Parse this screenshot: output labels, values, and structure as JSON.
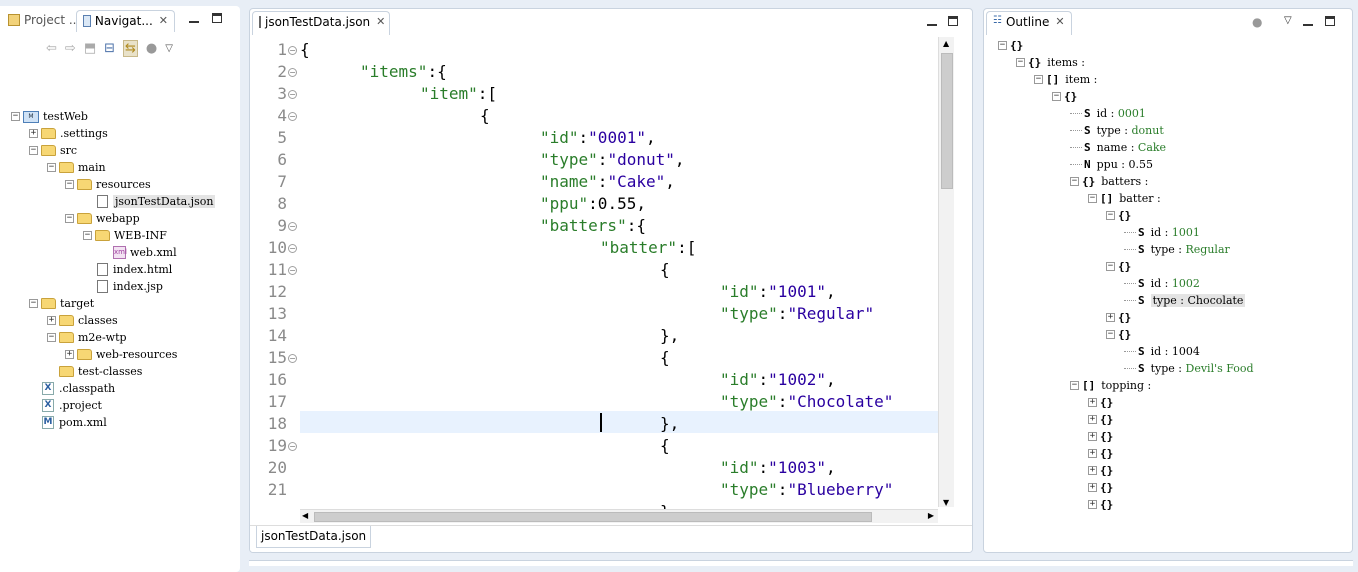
{
  "navigator": {
    "tabs": [
      {
        "label": "Project ...",
        "active": false
      },
      {
        "label": "Navigat...",
        "active": true
      }
    ],
    "tree": [
      {
        "label": "testWeb",
        "kind": "project",
        "level": 0,
        "expanded": true
      },
      {
        "label": ".settings",
        "kind": "folder",
        "level": 1,
        "expanded": false
      },
      {
        "label": "src",
        "kind": "folder",
        "level": 1,
        "expanded": true
      },
      {
        "label": "main",
        "kind": "folder",
        "level": 2,
        "expanded": true
      },
      {
        "label": "resources",
        "kind": "folder",
        "level": 3,
        "expanded": true
      },
      {
        "label": "jsonTestData.json",
        "kind": "file",
        "level": 4,
        "selected": true
      },
      {
        "label": "webapp",
        "kind": "folder",
        "level": 3,
        "expanded": true
      },
      {
        "label": "WEB-INF",
        "kind": "folder",
        "level": 4,
        "expanded": true
      },
      {
        "label": "web.xml",
        "kind": "xml",
        "level": 5
      },
      {
        "label": "index.html",
        "kind": "file",
        "level": 4
      },
      {
        "label": "index.jsp",
        "kind": "file",
        "level": 4
      },
      {
        "label": "target",
        "kind": "folder",
        "level": 1,
        "expanded": true
      },
      {
        "label": "classes",
        "kind": "folder",
        "level": 2,
        "expanded": false
      },
      {
        "label": "m2e-wtp",
        "kind": "folder",
        "level": 2,
        "expanded": true
      },
      {
        "label": "web-resources",
        "kind": "folder",
        "level": 3,
        "expanded": false
      },
      {
        "label": "test-classes",
        "kind": "folder",
        "level": 2,
        "leaf": true
      },
      {
        "label": ".classpath",
        "kind": "x",
        "level": 1
      },
      {
        "label": ".project",
        "kind": "x",
        "level": 1
      },
      {
        "label": "pom.xml",
        "kind": "m",
        "level": 1
      }
    ]
  },
  "editor": {
    "tab_label": "jsonTestData.json",
    "bottom_tab_label": "jsonTestData.json",
    "current_line": 18,
    "lines": [
      {
        "n": "1",
        "fold": true,
        "indent": 0,
        "parts": [
          [
            "punc",
            "{"
          ]
        ]
      },
      {
        "n": "2",
        "fold": true,
        "indent": 1,
        "parts": [
          [
            "key",
            "\"items\""
          ],
          [
            "punc",
            ":{"
          ]
        ]
      },
      {
        "n": "3",
        "fold": true,
        "indent": 2,
        "parts": [
          [
            "key",
            "\"item\""
          ],
          [
            "punc",
            ":["
          ]
        ]
      },
      {
        "n": "4",
        "fold": true,
        "indent": 3,
        "parts": [
          [
            "punc",
            "{"
          ]
        ]
      },
      {
        "n": "5",
        "fold": false,
        "indent": 4,
        "parts": [
          [
            "key",
            "\"id\""
          ],
          [
            "punc",
            ":"
          ],
          [
            "str",
            "\"0001\""
          ],
          [
            "punc",
            ","
          ]
        ]
      },
      {
        "n": "6",
        "fold": false,
        "indent": 4,
        "parts": [
          [
            "key",
            "\"type\""
          ],
          [
            "punc",
            ":"
          ],
          [
            "str",
            "\"donut\""
          ],
          [
            "punc",
            ","
          ]
        ]
      },
      {
        "n": "7",
        "fold": false,
        "indent": 4,
        "parts": [
          [
            "key",
            "\"name\""
          ],
          [
            "punc",
            ":"
          ],
          [
            "str",
            "\"Cake\""
          ],
          [
            "punc",
            ","
          ]
        ]
      },
      {
        "n": "8",
        "fold": false,
        "indent": 4,
        "parts": [
          [
            "key",
            "\"ppu\""
          ],
          [
            "punc",
            ":0.55,"
          ]
        ]
      },
      {
        "n": "9",
        "fold": true,
        "indent": 4,
        "parts": [
          [
            "key",
            "\"batters\""
          ],
          [
            "punc",
            ":{"
          ]
        ]
      },
      {
        "n": "10",
        "fold": true,
        "indent": 5,
        "parts": [
          [
            "key",
            "\"batter\""
          ],
          [
            "punc",
            ":["
          ]
        ]
      },
      {
        "n": "11",
        "fold": true,
        "indent": 6,
        "parts": [
          [
            "punc",
            "{"
          ]
        ]
      },
      {
        "n": "12",
        "fold": false,
        "indent": 7,
        "parts": [
          [
            "key",
            "\"id\""
          ],
          [
            "punc",
            ":"
          ],
          [
            "str",
            "\"1001\""
          ],
          [
            "punc",
            ","
          ]
        ]
      },
      {
        "n": "13",
        "fold": false,
        "indent": 7,
        "parts": [
          [
            "key",
            "\"type\""
          ],
          [
            "punc",
            ":"
          ],
          [
            "str",
            "\"Regular\""
          ]
        ]
      },
      {
        "n": "14",
        "fold": false,
        "indent": 6,
        "parts": [
          [
            "punc",
            "},"
          ]
        ]
      },
      {
        "n": "15",
        "fold": true,
        "indent": 6,
        "parts": [
          [
            "punc",
            "{"
          ]
        ]
      },
      {
        "n": "16",
        "fold": false,
        "indent": 7,
        "parts": [
          [
            "key",
            "\"id\""
          ],
          [
            "punc",
            ":"
          ],
          [
            "str",
            "\"1002\""
          ],
          [
            "punc",
            ","
          ]
        ]
      },
      {
        "n": "17",
        "fold": false,
        "indent": 7,
        "parts": [
          [
            "key",
            "\"type\""
          ],
          [
            "punc",
            ":"
          ],
          [
            "str",
            "\"Chocolate\""
          ]
        ]
      },
      {
        "n": "18",
        "fold": false,
        "indent": 6,
        "parts": [
          [
            "punc",
            "},"
          ]
        ]
      },
      {
        "n": "19",
        "fold": true,
        "indent": 6,
        "parts": [
          [
            "punc",
            "{"
          ]
        ]
      },
      {
        "n": "20",
        "fold": false,
        "indent": 7,
        "parts": [
          [
            "key",
            "\"id\""
          ],
          [
            "punc",
            ":"
          ],
          [
            "str",
            "\"1003\""
          ],
          [
            "punc",
            ","
          ]
        ]
      },
      {
        "n": "21",
        "fold": false,
        "indent": 7,
        "parts": [
          [
            "key",
            "\"type\""
          ],
          [
            "punc",
            ":"
          ],
          [
            "str",
            "\"Blueberry\""
          ]
        ]
      }
    ],
    "cut_line": "}"
  },
  "outline": {
    "tab_label": "Outline",
    "nodes": [
      {
        "level": 0,
        "badge": "{}",
        "label": "",
        "value": "",
        "exp": "-"
      },
      {
        "level": 1,
        "badge": "{}",
        "label": "items :",
        "value": "",
        "exp": "-"
      },
      {
        "level": 2,
        "badge": "[]",
        "label": "item :",
        "value": "",
        "exp": "-"
      },
      {
        "level": 3,
        "badge": "{}",
        "label": "",
        "value": "",
        "exp": "-"
      },
      {
        "level": 4,
        "badge": "S",
        "label": "id : ",
        "value": "0001"
      },
      {
        "level": 4,
        "badge": "S",
        "label": "type : ",
        "value": "donut"
      },
      {
        "level": 4,
        "badge": "S",
        "label": "name : ",
        "value": "Cake"
      },
      {
        "level": 4,
        "badge": "N",
        "label": "ppu : ",
        "value": "0.55",
        "plain": true
      },
      {
        "level": 4,
        "badge": "{}",
        "label": "batters :",
        "value": "",
        "exp": "-"
      },
      {
        "level": 5,
        "badge": "[]",
        "label": "batter :",
        "value": "",
        "exp": "-"
      },
      {
        "level": 6,
        "badge": "{}",
        "label": "",
        "value": "",
        "exp": "-"
      },
      {
        "level": 7,
        "badge": "S",
        "label": "id : ",
        "value": "1001"
      },
      {
        "level": 7,
        "badge": "S",
        "label": "type : ",
        "value": "Regular"
      },
      {
        "level": 6,
        "badge": "{}",
        "label": "",
        "value": "",
        "exp": "-"
      },
      {
        "level": 7,
        "badge": "S",
        "label": "id : ",
        "value": "1002"
      },
      {
        "level": 7,
        "badge": "S",
        "label": "type : ",
        "value": "Chocolate",
        "selected": true
      },
      {
        "level": 6,
        "badge": "{}",
        "label": "",
        "value": "",
        "exp": "+"
      },
      {
        "level": 6,
        "badge": "{}",
        "label": "",
        "value": "",
        "exp": "-"
      },
      {
        "level": 7,
        "badge": "S",
        "label": "id : ",
        "value": "1004",
        "plain": true
      },
      {
        "level": 7,
        "badge": "S",
        "label": "type : ",
        "value": "Devil's Food"
      },
      {
        "level": 3,
        "badge": "[]",
        "label": "topping :",
        "value": "",
        "exp": "-",
        "indent_override": 4
      },
      {
        "level": 5,
        "badge": "{}",
        "label": "",
        "value": "",
        "exp": "+"
      },
      {
        "level": 5,
        "badge": "{}",
        "label": "",
        "value": "",
        "exp": "+"
      },
      {
        "level": 5,
        "badge": "{}",
        "label": "",
        "value": "",
        "exp": "+"
      },
      {
        "level": 5,
        "badge": "{}",
        "label": "",
        "value": "",
        "exp": "+"
      },
      {
        "level": 5,
        "badge": "{}",
        "label": "",
        "value": "",
        "exp": "+"
      },
      {
        "level": 5,
        "badge": "{}",
        "label": "",
        "value": "",
        "exp": "+"
      },
      {
        "level": 5,
        "badge": "{}",
        "label": "",
        "value": "",
        "exp": "+"
      }
    ]
  }
}
